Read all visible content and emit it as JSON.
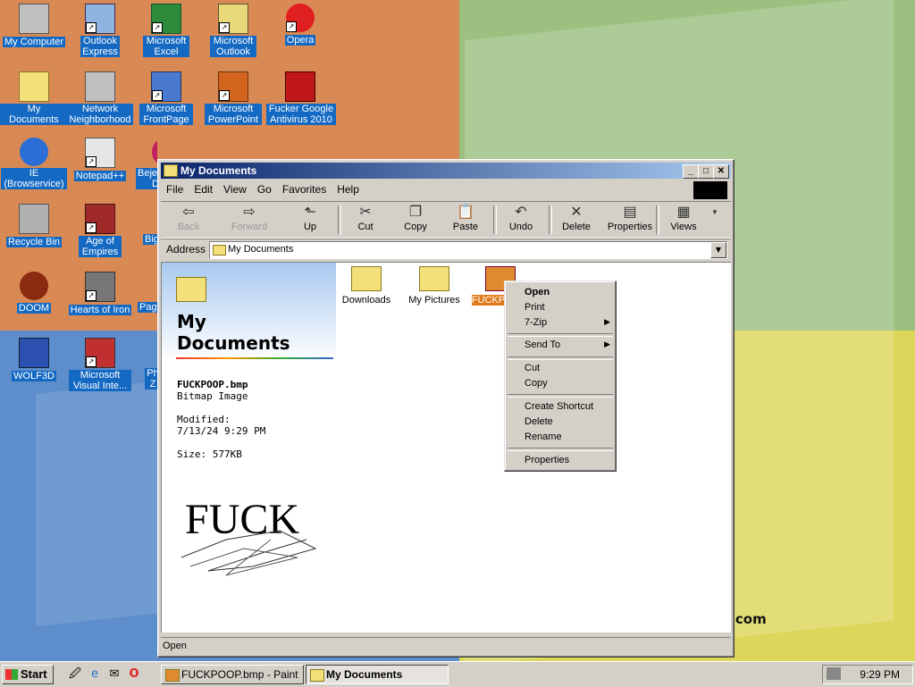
{
  "desktop": {
    "icons": [
      {
        "label": "My Computer"
      },
      {
        "label": "Outlook Express"
      },
      {
        "label": "Microsoft Excel"
      },
      {
        "label": "Microsoft Outlook"
      },
      {
        "label": "Opera"
      },
      {
        "label": "My Documents"
      },
      {
        "label": "Network Neighborhood"
      },
      {
        "label": "Microsoft FrontPage"
      },
      {
        "label": "Microsoft PowerPoint"
      },
      {
        "label": "Fucker Google Antivirus 2010"
      },
      {
        "label": "IE (Browservice)"
      },
      {
        "label": "Notepad++"
      },
      {
        "label": "Bejeweled D"
      },
      {
        "label": "Recycle Bin"
      },
      {
        "label": "Age of Empires"
      },
      {
        "label": "Big"
      },
      {
        "label": "DOOM"
      },
      {
        "label": "Hearts of Iron"
      },
      {
        "label": "Pagg"
      },
      {
        "label": "WOLF3D"
      },
      {
        "label": "Microsoft Visual Inte..."
      },
      {
        "label": "Ph Z"
      }
    ],
    "wallpaper_text": "t.com"
  },
  "window": {
    "title": "My Documents",
    "menu": [
      "File",
      "Edit",
      "View",
      "Go",
      "Favorites",
      "Help"
    ],
    "toolbar": [
      "Back",
      "Forward",
      "Up",
      "Cut",
      "Copy",
      "Paste",
      "Undo",
      "Delete",
      "Properties",
      "Views"
    ],
    "address_label": "Address",
    "address_value": "My Documents",
    "left_pane": {
      "title_line1": "My",
      "title_line2": "Documents",
      "file_name": "FUCKPOOP.bmp",
      "file_type": "Bitmap Image",
      "modified_label": "Modified:",
      "modified_value": "7/13/24 9:29 PM",
      "size": "Size: 577KB",
      "preview_text": "FUCK"
    },
    "files": [
      {
        "label": "Downloads"
      },
      {
        "label": "My Pictures"
      },
      {
        "label": "FUCKPO mp"
      }
    ],
    "status": "Open"
  },
  "context_menu": {
    "items": [
      "Open",
      "Print",
      "7-Zip",
      "Send To",
      "Cut",
      "Copy",
      "Create Shortcut",
      "Delete",
      "Rename",
      "Properties"
    ]
  },
  "taskbar": {
    "start": "Start",
    "buttons": [
      "FUCKPOOP.bmp - Paint",
      "My Documents"
    ],
    "clock": "9:29 PM"
  }
}
